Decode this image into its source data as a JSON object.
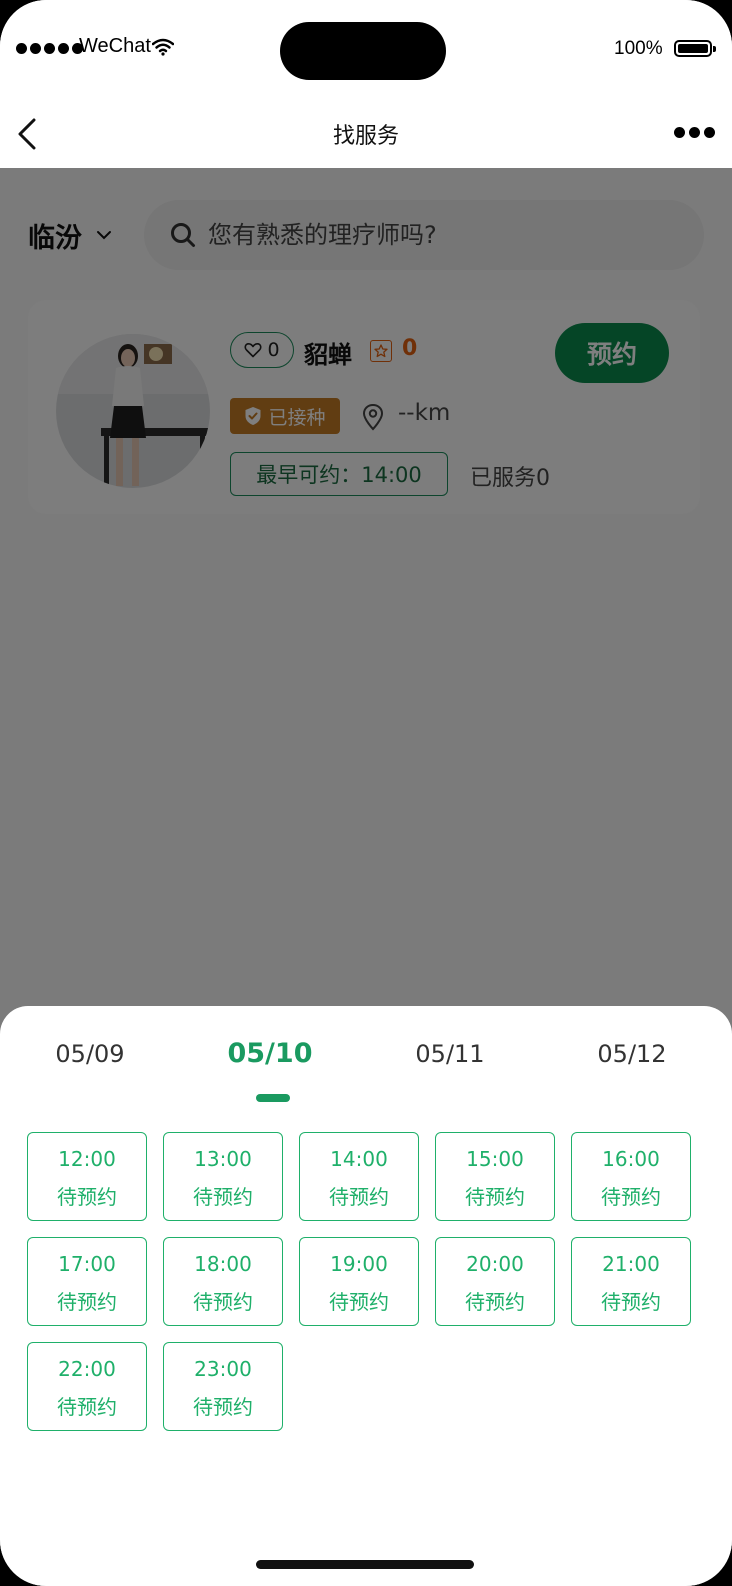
{
  "status_bar": {
    "carrier": "WeChat",
    "battery_percent": "100%"
  },
  "nav": {
    "title": "找服务"
  },
  "filter": {
    "city": "临汾",
    "search_placeholder": "您有熟悉的理疗师吗?"
  },
  "therapist": {
    "likes": "0",
    "name": "貂蝉",
    "stars": "0",
    "book_label": "预约",
    "vaccine_label": "已接种",
    "distance": "--km",
    "earliest": "最早可约：14:00",
    "served": "已服务0"
  },
  "dates": [
    "05/09",
    "05/10",
    "05/11",
    "05/12"
  ],
  "selected_date": "05/10",
  "slots": [
    {
      "time": "12:00",
      "status": "待预约"
    },
    {
      "time": "13:00",
      "status": "待预约"
    },
    {
      "time": "14:00",
      "status": "待预约"
    },
    {
      "time": "15:00",
      "status": "待预约"
    },
    {
      "time": "16:00",
      "status": "待预约"
    },
    {
      "time": "17:00",
      "status": "待预约"
    },
    {
      "time": "18:00",
      "status": "待预约"
    },
    {
      "time": "19:00",
      "status": "待预约"
    },
    {
      "time": "20:00",
      "status": "待预约"
    },
    {
      "time": "21:00",
      "status": "待预约"
    },
    {
      "time": "22:00",
      "status": "待预约"
    },
    {
      "time": "23:00",
      "status": "待预约"
    }
  ],
  "colors": {
    "accent": "#1fb06a",
    "book_button": "#0b8a4c",
    "vaccine_badge": "#c27a25",
    "stars": "#e06010"
  }
}
